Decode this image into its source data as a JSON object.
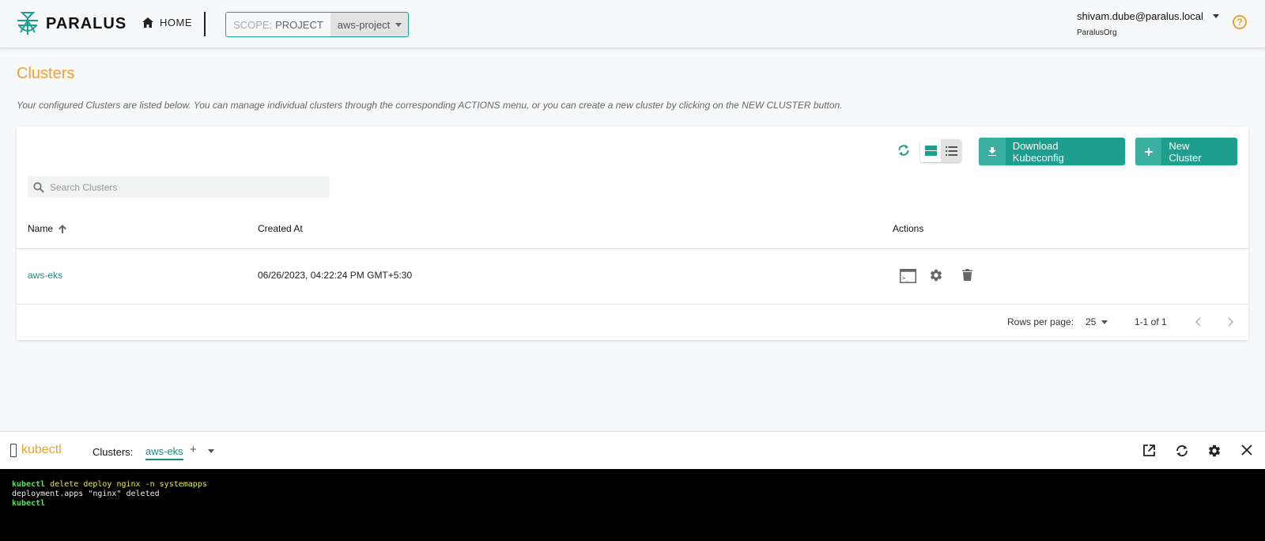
{
  "header": {
    "brand": "PARALUS",
    "home_label": "HOME",
    "scope_key": "SCOPE:",
    "scope_value": "PROJECT",
    "project": "aws-project",
    "user_email": "shivam.dube@paralus.local",
    "org": "ParalusOrg",
    "help": "?"
  },
  "page": {
    "title": "Clusters",
    "description": "Your configured Clusters are listed below. You can manage individual clusters through the corresponding ACTIONS menu, or you can create a new cluster by clicking on the NEW CLUSTER button."
  },
  "toolbar": {
    "download_label": "Download Kubeconfig",
    "new_label": "New Cluster"
  },
  "search": {
    "placeholder": "Search Clusters"
  },
  "table": {
    "columns": {
      "name": "Name",
      "created": "Created At",
      "actions": "Actions"
    },
    "rows": [
      {
        "name": "aws-eks",
        "created": "06/26/2023, 04:22:24 PM GMT+5:30"
      }
    ]
  },
  "pagination": {
    "rows_label": "Rows per page:",
    "rows_value": "25",
    "range": "1-1 of 1"
  },
  "kubectl": {
    "brand": "kubectl",
    "clusters_label": "Clusters:",
    "active_tab": "aws-eks",
    "add": "+",
    "lines": [
      {
        "prompt": "kubectl",
        "cmd": " delete deploy nginx -n systemapps"
      },
      {
        "output": "deployment.apps \"nginx\" deleted"
      },
      {
        "prompt": "kubectl",
        "cmd": ""
      }
    ]
  },
  "colors": {
    "accent": "#1e9e8e",
    "title": "#f0a030",
    "terminal_bg": "#000000"
  }
}
